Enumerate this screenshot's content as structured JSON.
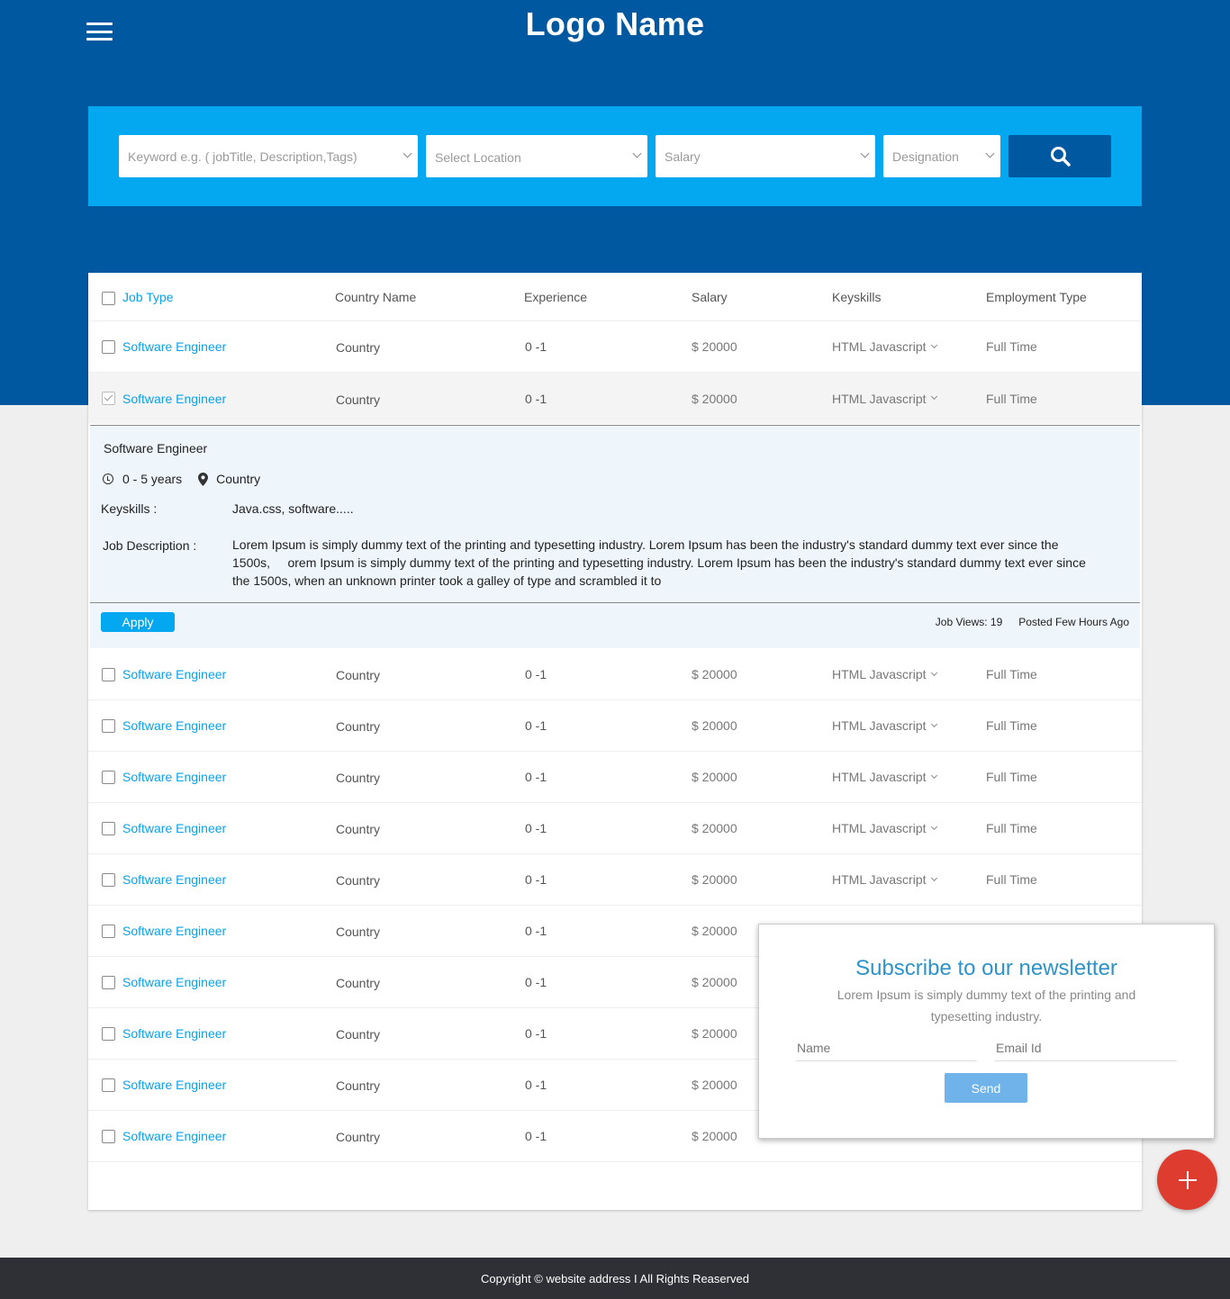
{
  "header": {
    "logo": "Logo Name"
  },
  "search": {
    "keyword_placeholder": "Keyword e.g. ( jobTitle, Description,Tags)",
    "location_placeholder": "Select Location",
    "salary_placeholder": "Salary",
    "designation_placeholder": "Designation"
  },
  "table": {
    "columns": [
      "Job Type",
      "Country Name",
      "Experience",
      "Salary",
      "Keyskills",
      "Employment Type"
    ],
    "rows": [
      {
        "title": "Software Engineer",
        "country": "Country",
        "experience": "0 -1",
        "salary": "$ 20000",
        "keyskills": "HTML Javascript",
        "employment": "Full Time",
        "checked": false
      },
      {
        "title": "Software Engineer",
        "country": "Country",
        "experience": "0 -1",
        "salary": "$ 20000",
        "keyskills": "HTML Javascript",
        "employment": "Full Time",
        "checked": true
      },
      {
        "title": "Software Engineer",
        "country": "Country",
        "experience": "0 -1",
        "salary": "$ 20000",
        "keyskills": "HTML Javascript",
        "employment": "Full Time",
        "checked": false
      },
      {
        "title": "Software Engineer",
        "country": "Country",
        "experience": "0 -1",
        "salary": "$ 20000",
        "keyskills": "HTML Javascript",
        "employment": "Full Time",
        "checked": false
      },
      {
        "title": "Software Engineer",
        "country": "Country",
        "experience": "0 -1",
        "salary": "$ 20000",
        "keyskills": "HTML Javascript",
        "employment": "Full Time",
        "checked": false
      },
      {
        "title": "Software Engineer",
        "country": "Country",
        "experience": "0 -1",
        "salary": "$ 20000",
        "keyskills": "HTML Javascript",
        "employment": "Full Time",
        "checked": false
      },
      {
        "title": "Software Engineer",
        "country": "Country",
        "experience": "0 -1",
        "salary": "$ 20000",
        "keyskills": "HTML Javascript",
        "employment": "Full Time",
        "checked": false
      },
      {
        "title": "Software Engineer",
        "country": "Country",
        "experience": "0 -1",
        "salary": "$ 20000",
        "keyskills": "",
        "employment": "",
        "checked": false
      },
      {
        "title": "Software Engineer",
        "country": "Country",
        "experience": "0 -1",
        "salary": "$ 20000",
        "keyskills": "",
        "employment": "",
        "checked": false
      },
      {
        "title": "Software Engineer",
        "country": "Country",
        "experience": "0 -1",
        "salary": "$ 20000",
        "keyskills": "",
        "employment": "",
        "checked": false
      },
      {
        "title": "Software Engineer",
        "country": "Country",
        "experience": "0 -1",
        "salary": "$ 20000",
        "keyskills": "",
        "employment": "",
        "checked": false
      },
      {
        "title": "Software Engineer",
        "country": "Country",
        "experience": "0 -1",
        "salary": "$ 20000",
        "keyskills": "",
        "employment": "",
        "checked": false
      }
    ]
  },
  "detail": {
    "title": "Software Engineer",
    "experience": "0 - 5 years",
    "location": "Country",
    "keyskills_label": "Keyskills :",
    "keyskills": "Java.css, software.....",
    "description_label": "Job Description :",
    "description": "Lorem Ipsum is simply dummy text of the printing and typesetting industry. Lorem Ipsum has been the industry's standard dummy text ever since the 1500s,     orem Ipsum is simply dummy text of the printing and typesetting industry. Lorem Ipsum has been the industry's standard dummy text ever since the 1500s, when an unknown printer took a galley of type and scrambled it to",
    "apply_label": "Apply",
    "views": "Job Views: 19",
    "posted": "Posted Few Hours Ago"
  },
  "newsletter": {
    "title": "Subscribe to our newsletter",
    "description": "Lorem Ipsum is simply dummy text of the printing and typesetting industry.",
    "name_placeholder": "Name",
    "email_placeholder": "Email Id",
    "send_label": "Send"
  },
  "footer": {
    "text": "Copyright © website address I All Rights Reaserved"
  },
  "colors": {
    "primary": "#0058a1",
    "accent": "#04a8f0",
    "fab": "#de3c2f",
    "footer": "#2e3035"
  },
  "icons": [
    "menu-icon",
    "search-icon",
    "chevron-down-icon",
    "clock-icon",
    "location-pin-icon",
    "plus-icon"
  ]
}
